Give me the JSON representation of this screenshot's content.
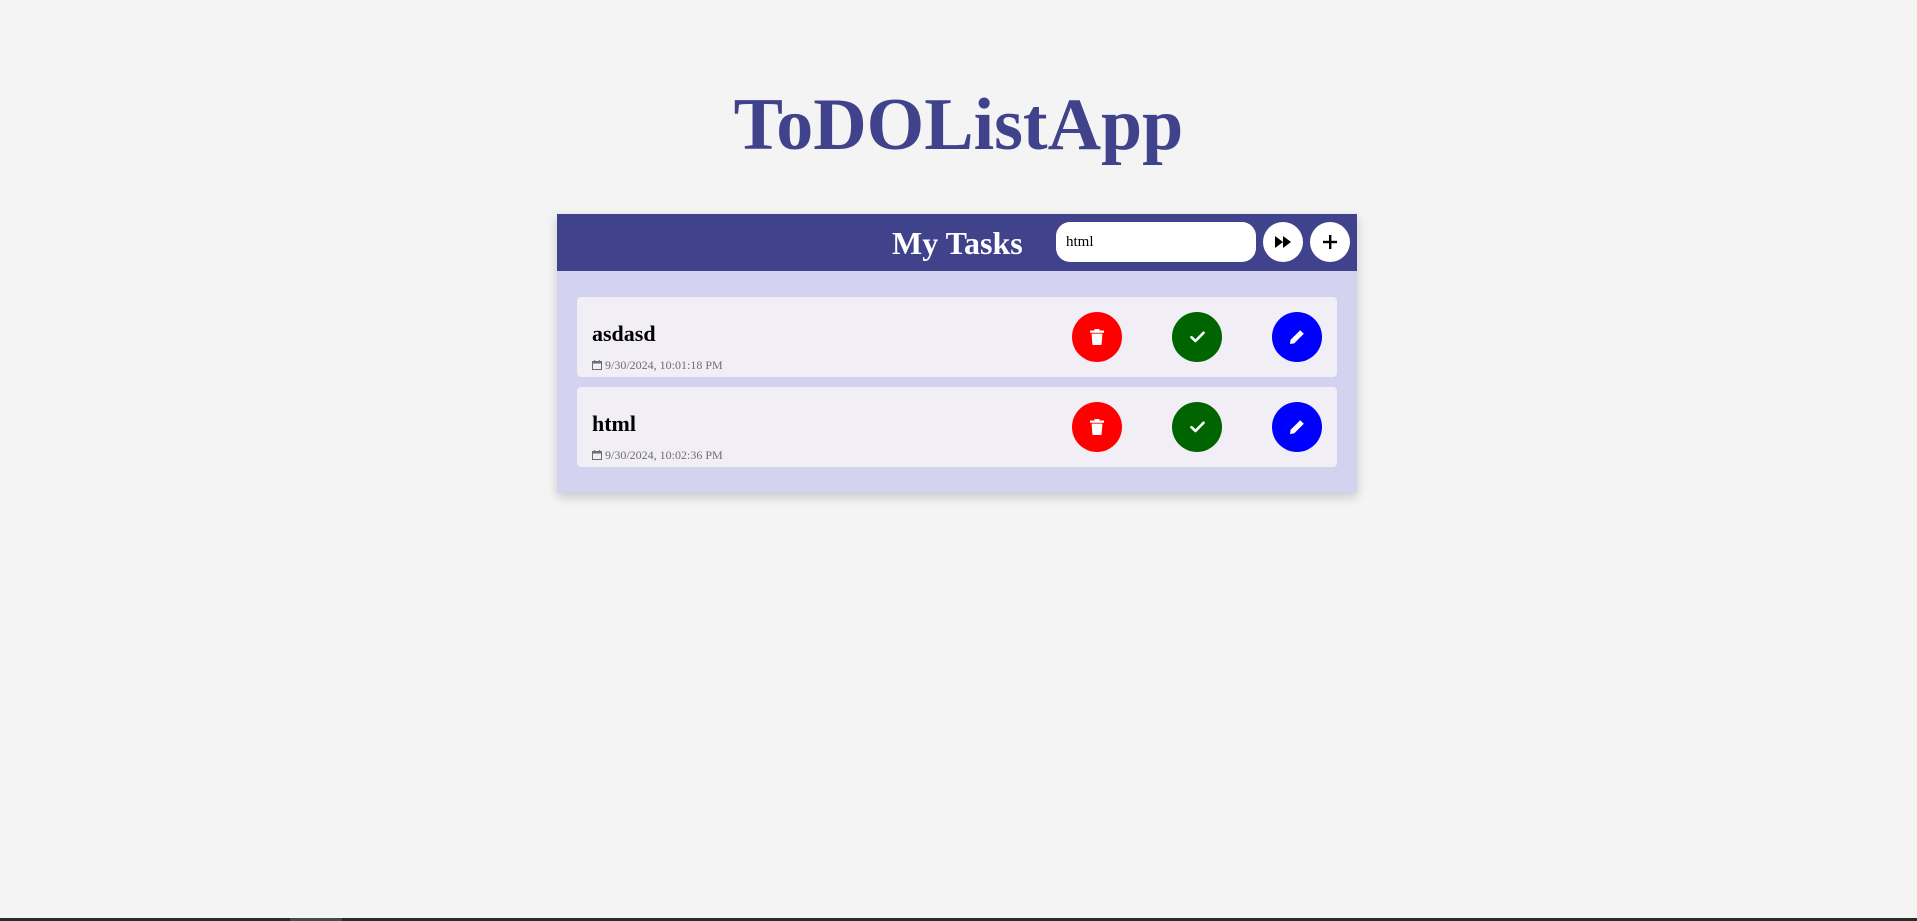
{
  "app": {
    "title": "ToDOListApp"
  },
  "header": {
    "title": "My Tasks",
    "search_value": "html",
    "search_placeholder": "",
    "forward_icon": "fast-forward-icon",
    "add_icon": "plus-icon"
  },
  "tasks": [
    {
      "name": "asdasd",
      "date": "9/30/2024, 10:01:18 PM"
    },
    {
      "name": "html",
      "date": "9/30/2024, 10:02:36 PM"
    }
  ],
  "actions": {
    "delete_icon": "trash-icon",
    "done_icon": "check-icon",
    "edit_icon": "pencil-icon"
  },
  "colors": {
    "title": "#40438c",
    "header_bg": "#40438c",
    "card_bg": "#d3d3f0",
    "task_bg": "#f1eff5",
    "delete": "#ff0000",
    "done": "#006400",
    "edit": "#0000ff",
    "page_bg": "#f4f4f5"
  }
}
